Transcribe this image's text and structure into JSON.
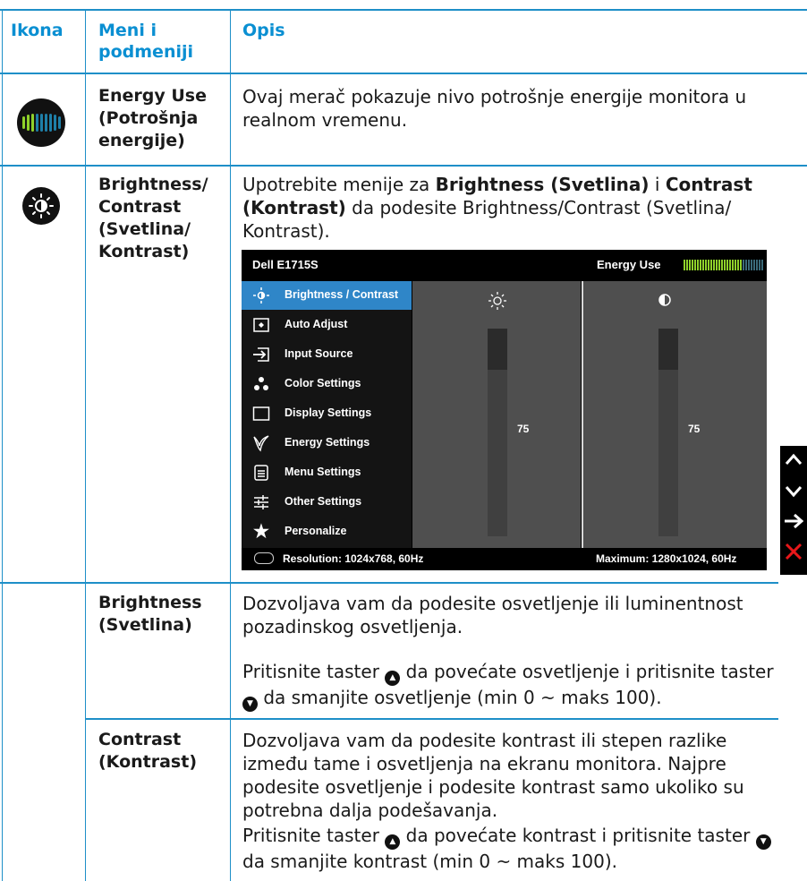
{
  "headers": {
    "icon": "Ikona",
    "menu": "Meni i podmeniji",
    "desc": "Opis"
  },
  "rows": {
    "energy": {
      "icon": "energy-meter-icon",
      "menu": "Energy Use (Potrošnja energije)",
      "desc": "Ovaj merač pokazuje nivo potrošnje energije monitora u realnom vremenu."
    },
    "brightness_contrast": {
      "icon": "brightness-icon",
      "menu": "Brightness/ Contrast (Svetlina/ Kontrast)",
      "desc_pre": "Upotrebite menije za ",
      "desc_b1": "Brightness (Svetlina)",
      "desc_mid": " i ",
      "desc_b2": "Contrast (Kontrast)",
      "desc_post": " da podesite Brightness/Contrast (Svetlina/ Kontrast)."
    },
    "brightness": {
      "menu": "Brightness (Svetlina)",
      "desc1": "Dozvoljava vam da podesite osvetljenje ili luminentnost pozadinskog osvetljenja.",
      "desc2_a": "Pritisnite taster ",
      "desc2_b": " da povećate osvetljenje i pritisnite taster ",
      "desc2_c": " da smanjite osvetljenje (min 0 ~ maks 100)."
    },
    "contrast": {
      "menu": "Contrast (Kontrast)",
      "desc1": "Dozvoljava vam da podesite kontrast ili stepen razlike između tame i osvetljenja na ekranu monitora. Najpre podesite osvetljenje i podesite kontrast samo ukoliko su potrebna dalja podešavanja.",
      "desc2_a": "Pritisnite taster ",
      "desc2_b": " da povećate kontrast i pritisnite taster ",
      "desc2_c": " da smanjite kontrast (min 0 ~ maks 100)."
    }
  },
  "osd": {
    "model": "Dell E1715S",
    "energy_label": "Energy Use",
    "menu": [
      {
        "label": "Brightness / Contrast",
        "icon": "brightness-icon",
        "selected": true
      },
      {
        "label": "Auto Adjust",
        "icon": "auto-adjust-icon",
        "selected": false
      },
      {
        "label": "Input Source",
        "icon": "input-source-icon",
        "selected": false
      },
      {
        "label": "Color Settings",
        "icon": "color-settings-icon",
        "selected": false
      },
      {
        "label": "Display Settings",
        "icon": "display-settings-icon",
        "selected": false
      },
      {
        "label": "Energy Settings",
        "icon": "energy-settings-icon",
        "selected": false
      },
      {
        "label": "Menu Settings",
        "icon": "menu-settings-icon",
        "selected": false
      },
      {
        "label": "Other Settings",
        "icon": "other-settings-icon",
        "selected": false
      },
      {
        "label": "Personalize",
        "icon": "star-icon",
        "selected": false
      }
    ],
    "brightness_value": "75",
    "contrast_value": "75",
    "resolution": "Resolution: 1024x768, 60Hz",
    "maximum": "Maximum: 1280x1024, 60Hz"
  },
  "colors": {
    "accent": "#1e8fc8",
    "osd_selected": "#2f86c8",
    "meter_green": "#8fd12a"
  }
}
